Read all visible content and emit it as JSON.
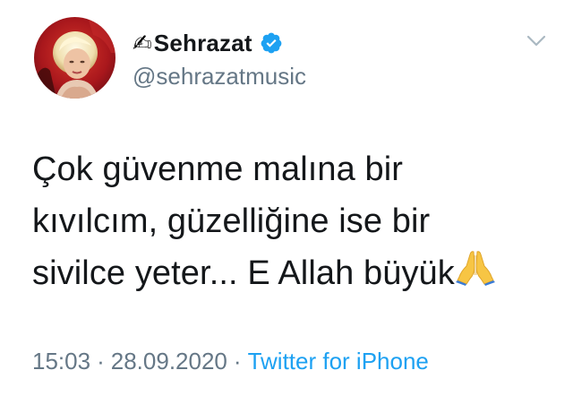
{
  "tweet": {
    "author": {
      "name_emoji": "✍",
      "display_name": "Sehrazat",
      "verified": true,
      "handle": "@sehrazatmusic"
    },
    "text_lines": [
      "Çok güvenme malına bir",
      "kıvılcım, güzelliğine ise bir",
      "sivilce yeter... E Allah büyük"
    ],
    "trailing_emoji": "praying-hands",
    "time": "15:03",
    "separator": "·",
    "date": "28.09.2020",
    "source": "Twitter for iPhone"
  },
  "icons": {
    "verified": "verified-badge-icon",
    "menu": "chevron-down-icon"
  },
  "colors": {
    "text_primary": "#14171a",
    "text_secondary": "#657786",
    "link": "#1da1f2",
    "verified": "#1da1f2",
    "background": "#ffffff"
  }
}
